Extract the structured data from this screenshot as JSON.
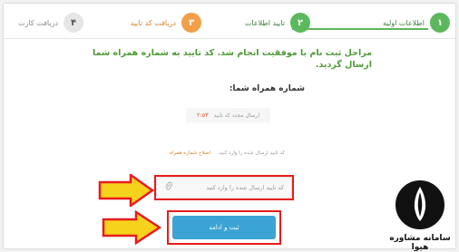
{
  "steps": [
    {
      "number": "۱",
      "label": "اطلاعات اولیه"
    },
    {
      "number": "۲",
      "label": "تایید اطلاعات"
    },
    {
      "number": "۳",
      "label": "دریافت کد تایید"
    },
    {
      "number": "۴",
      "label": "دریافت کارت"
    }
  ],
  "message": "مراحل ثبت نام با موفقیت انجام شد. کد تایید به شماره همراه شما ارسال گردید.",
  "phone_label": "شماره همراه شما:",
  "resend": {
    "label": "ارسال مجدد کد تایید",
    "timer": "۲:۵۳"
  },
  "hint": {
    "text": "کد تایید ارسال شده را وارد کنید.",
    "link": "اصلاح شماره همراه"
  },
  "code_input": {
    "placeholder": "کد تایید ارسال شده را وارد کنید"
  },
  "submit_label": "ثبت و ادامه",
  "logo_text": "سامانه مشاوره هیوا",
  "colors": {
    "green": "#5cb85c",
    "orange": "#f0a04b",
    "blue": "#3ba4d4",
    "red_highlight": "#e81c1c",
    "arrow_yellow": "#f5d21c"
  }
}
